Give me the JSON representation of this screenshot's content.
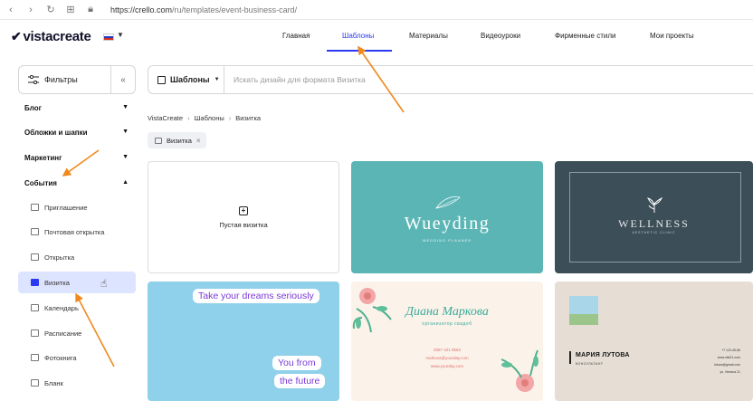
{
  "browser": {
    "url_main": "https://crello.com",
    "url_path": "/ru/templates/event-business-card/"
  },
  "header": {
    "logo": "vistacreate",
    "nav": [
      {
        "label": "Главная"
      },
      {
        "label": "Шаблоны",
        "active": true
      },
      {
        "label": "Материалы"
      },
      {
        "label": "Видеоуроки"
      },
      {
        "label": "Фирменные стили"
      },
      {
        "label": "Мои проекты"
      }
    ],
    "accent_color": "#2b3af0"
  },
  "filters": {
    "label": "Фильтры",
    "collapse_icon": "double-chevron-left-icon"
  },
  "sidebar": {
    "categories": [
      {
        "label": "Блог",
        "state": "collapsed"
      },
      {
        "label": "Обложки и шапки",
        "state": "collapsed"
      },
      {
        "label": "Маркетинг",
        "state": "collapsed"
      },
      {
        "label": "События",
        "state": "expanded"
      }
    ],
    "subitems": [
      {
        "label": "Приглашение",
        "active": false
      },
      {
        "label": "Почтовая открытка",
        "active": false
      },
      {
        "label": "Открытка",
        "active": false
      },
      {
        "label": "Визитка",
        "active": true
      },
      {
        "label": "Календарь",
        "active": false
      },
      {
        "label": "Расписание",
        "active": false
      },
      {
        "label": "Фотокнига",
        "active": false
      },
      {
        "label": "Бланк",
        "active": false
      }
    ]
  },
  "search": {
    "type_label": "Шаблоны",
    "placeholder": "Искать дизайн для формата Визитка"
  },
  "breadcrumb": [
    "VistaCreate",
    "Шаблоны",
    "Визитка"
  ],
  "filter_chip": {
    "label": "Визитка"
  },
  "cards": {
    "blank": {
      "label": "Пустая визитка"
    },
    "teal": {
      "title": "Wueyding",
      "subtitle": "WEDDING PLANNER"
    },
    "dark": {
      "title": "WELLNESS",
      "subtitle": "AESTHETIC CLINIC"
    },
    "blue": {
      "line1": "Take your dreams seriously",
      "line2": "You from",
      "line3": "the future"
    },
    "floral": {
      "name": "Диана Маркова",
      "role": "организатор свадеб",
      "phone": "2567 221 8563",
      "email": "markova@yourday.com",
      "site": "www.yourday.com"
    },
    "beige": {
      "name": "МАРИЯ ЛУТОВА",
      "role": "КОНСУЛЬТАНТ",
      "contacts": [
        "+7 123-45-56",
        "www.site21.com",
        "lutova@gmail.com",
        "ул. Ленина 21"
      ]
    }
  }
}
